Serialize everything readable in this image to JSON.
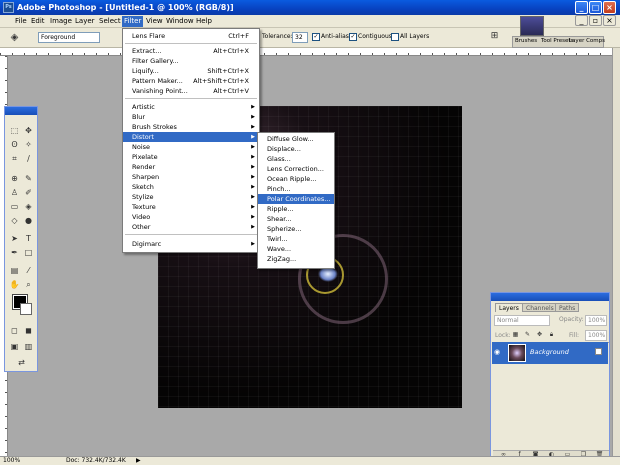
{
  "title": "Adobe Photoshop - [Untitled-1 @ 100% (RGB/8)]",
  "menus": [
    "File",
    "Edit",
    "Image",
    "Layer",
    "Select",
    "Filter",
    "View",
    "Window",
    "Help"
  ],
  "options": {
    "mode_value": "Foreground",
    "tolerance_label": "Tolerance:",
    "tolerance_value": "32",
    "antialias_label": "Anti-alias",
    "contiguous_label": "Contiguous",
    "alllayers_label": "All Layers",
    "palette_tabs": [
      "Brushes",
      "Tool Presets",
      "Layer Comps"
    ]
  },
  "filter_menu": {
    "items": [
      {
        "label": "Lens Flare",
        "shortcut": "Ctrl+F"
      },
      {
        "label": "Extract...",
        "shortcut": "Alt+Ctrl+X"
      },
      {
        "label": "Filter Gallery...",
        "shortcut": ""
      },
      {
        "label": "Liquify...",
        "shortcut": "Shift+Ctrl+X"
      },
      {
        "label": "Pattern Maker...",
        "shortcut": "Alt+Shift+Ctrl+X"
      },
      {
        "label": "Vanishing Point...",
        "shortcut": "Alt+Ctrl+V"
      },
      {
        "label": "Artistic",
        "shortcut": ""
      },
      {
        "label": "Blur",
        "shortcut": ""
      },
      {
        "label": "Brush Strokes",
        "shortcut": ""
      },
      {
        "label": "Distort",
        "shortcut": ""
      },
      {
        "label": "Noise",
        "shortcut": ""
      },
      {
        "label": "Pixelate",
        "shortcut": ""
      },
      {
        "label": "Render",
        "shortcut": ""
      },
      {
        "label": "Sharpen",
        "shortcut": ""
      },
      {
        "label": "Sketch",
        "shortcut": ""
      },
      {
        "label": "Stylize",
        "shortcut": ""
      },
      {
        "label": "Texture",
        "shortcut": ""
      },
      {
        "label": "Video",
        "shortcut": ""
      },
      {
        "label": "Other",
        "shortcut": ""
      },
      {
        "label": "Digimarc",
        "shortcut": ""
      }
    ]
  },
  "distort_submenu": [
    "Diffuse Glow...",
    "Displace...",
    "Glass...",
    "Lens Correction...",
    "Ocean Ripple...",
    "Pinch...",
    "Polar Coordinates...",
    "Ripple...",
    "Shear...",
    "Spherize...",
    "Twirl...",
    "Wave...",
    "ZigZag..."
  ],
  "layers_panel": {
    "tabs": [
      "Layers",
      "Channels",
      "Paths"
    ],
    "blend_mode": "Normal",
    "opacity_label": "Opacity:",
    "opacity_value": "100%",
    "lock_label": "Lock:",
    "fill_label": "Fill:",
    "fill_value": "100%",
    "layer_name": "Background"
  },
  "status": {
    "zoom": "100%",
    "doc": "Doc: 732.4K/732.4K"
  }
}
